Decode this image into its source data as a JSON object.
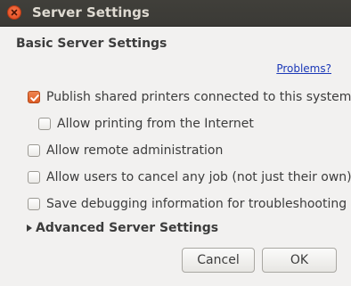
{
  "window": {
    "title": "Server Settings"
  },
  "basic": {
    "heading": "Basic Server Settings",
    "problems_link": "Problems?",
    "options": [
      {
        "label": "Publish shared printers connected to this system",
        "checked": true
      },
      {
        "label": "Allow printing from the Internet",
        "checked": false
      },
      {
        "label": "Allow remote administration",
        "checked": false
      },
      {
        "label": "Allow users to cancel any job (not just their own)",
        "checked": false
      },
      {
        "label": "Save debugging information for troubleshooting",
        "checked": false
      }
    ]
  },
  "advanced": {
    "label": "Advanced Server Settings",
    "expanded": false
  },
  "buttons": {
    "cancel": "Cancel",
    "ok": "OK"
  },
  "colors": {
    "titlebar": "#3c3b37",
    "accent_checkbox": "#e0561f",
    "link": "#1c39b8"
  },
  "icons": {
    "close": "close-icon",
    "check": "check-icon",
    "expander": "triangle-right-icon"
  }
}
